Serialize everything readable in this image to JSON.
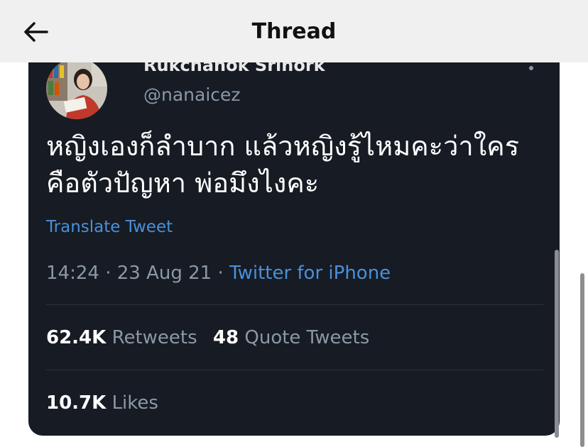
{
  "header": {
    "title": "Thread"
  },
  "tweet": {
    "author_name": "Rukchanok Srinork",
    "handle": "@nanaicez",
    "text": "หญิงเองก็ลำบาก แล้วหญิงรู้ไหมคะว่าใครคือตัวปัญหา พ่อมึงไงคะ",
    "translate_label": "Translate Tweet",
    "time": "14:24",
    "date": "23 Aug 21",
    "separator": "·",
    "source": "Twitter for iPhone",
    "retweets_count": "62.4K",
    "retweets_label": "Retweets",
    "quotes_count": "48",
    "quotes_label": "Quote Tweets",
    "likes_count": "10.7K",
    "likes_label": "Likes"
  },
  "colors": {
    "card_bg": "#161b24",
    "link": "#4a90d9",
    "muted": "#8b98a5"
  }
}
